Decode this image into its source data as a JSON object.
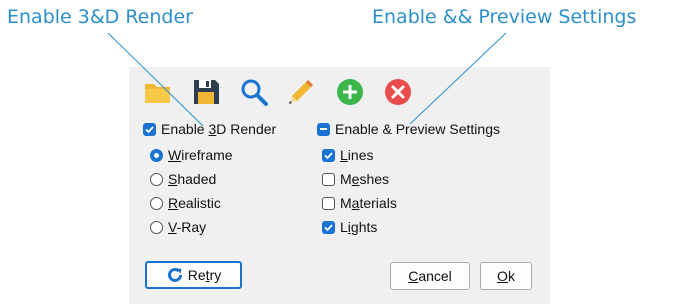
{
  "callouts": {
    "left": "Enable 3&D Render",
    "right": "Enable && Preview Settings"
  },
  "toolbar": {
    "icons": [
      "folder-icon",
      "save-icon",
      "search-icon",
      "pencil-icon",
      "add-icon",
      "close-icon"
    ]
  },
  "render": {
    "checkbox": {
      "prefix": "Enable ",
      "mnemonic": "3",
      "rest": "D Render",
      "state": "checked"
    },
    "options": [
      {
        "mnemonic": "W",
        "rest": "ireframe",
        "selected": true
      },
      {
        "mnemonic": "S",
        "rest": "haded",
        "selected": false
      },
      {
        "mnemonic": "R",
        "rest": "ealistic",
        "selected": false
      },
      {
        "mnemonic": "V",
        "rest": "-Ray",
        "selected": false
      }
    ]
  },
  "preview": {
    "checkbox": {
      "label": "Enable & Preview Settings",
      "state": "indeterminate"
    },
    "options": [
      {
        "pre": "",
        "mnemonic": "L",
        "rest": "ines",
        "checked": true
      },
      {
        "pre": "M",
        "mnemonic": "e",
        "rest": "shes",
        "checked": false
      },
      {
        "pre": "M",
        "mnemonic": "a",
        "rest": "terials",
        "checked": false
      },
      {
        "pre": "L",
        "mnemonic": "i",
        "rest": "ghts",
        "checked": true
      }
    ]
  },
  "buttons": {
    "retry": {
      "pre": "Re",
      "mnemonic": "t",
      "rest": "ry"
    },
    "cancel": {
      "mnemonic": "C",
      "rest": "ancel"
    },
    "ok": {
      "mnemonic": "O",
      "rest": "k"
    }
  },
  "colors": {
    "accent": "#1a73d2",
    "callout": "#2b8fcb",
    "panel": "#f0f0f0"
  }
}
